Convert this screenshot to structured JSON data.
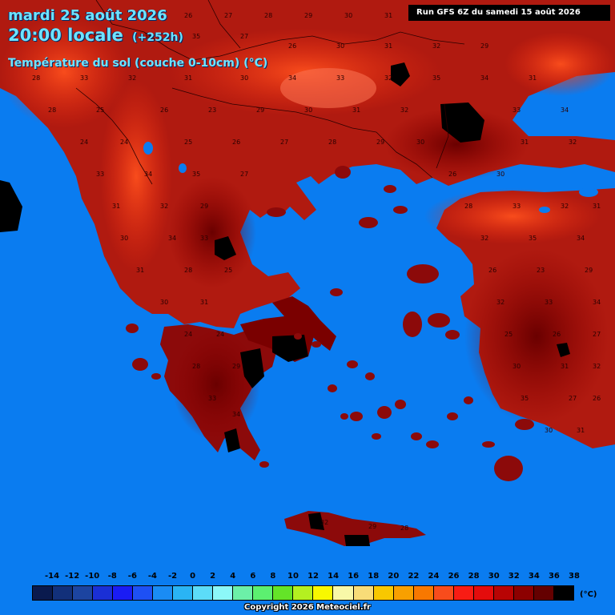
{
  "header": {
    "date": "mardi 25 août 2026",
    "time": "20:00 locale",
    "offset": "(+252h)",
    "parameter": "Température du sol (couche 0-10cm) (°C)"
  },
  "run_info": "Run GFS 6Z du samedi 15 août 2026",
  "legend": {
    "labels": [
      "-14",
      "-12",
      "-10",
      "-8",
      "-6",
      "-4",
      "-2",
      "0",
      "2",
      "4",
      "6",
      "8",
      "10",
      "12",
      "14",
      "16",
      "18",
      "20",
      "22",
      "24",
      "26",
      "28",
      "30",
      "32",
      "34",
      "36",
      "38"
    ],
    "colors": [
      "#0a1a4e",
      "#12307a",
      "#1c44a0",
      "#1a2fd6",
      "#1a1cf4",
      "#1e50f4",
      "#1a8cf4",
      "#2ab4f4",
      "#5cdcf8",
      "#8cf8f8",
      "#6cf0a8",
      "#5cf070",
      "#64e428",
      "#b4f020",
      "#f8f800",
      "#f8f8a8",
      "#f8dc78",
      "#f8c800",
      "#f8a000",
      "#f87800",
      "#f84c1c",
      "#f81c14",
      "#e40c0c",
      "#b80404",
      "#8c0000",
      "#640000",
      "#000000"
    ],
    "unit": "(°C)"
  },
  "colors": {
    "sea": "#0a7cf0",
    "land_warm": "#a01010",
    "land_hot": "#7a0000",
    "land_mild": "#e82a10",
    "border": "#2a0000"
  },
  "map_labels": [
    {
      "text": "24"
    },
    {
      "text": "24"
    },
    {
      "text": "25"
    },
    {
      "text": "26"
    },
    {
      "text": "27"
    },
    {
      "text": "28"
    },
    {
      "text": "29"
    },
    {
      "text": "30"
    },
    {
      "text": "31"
    },
    {
      "text": "32"
    },
    {
      "text": "33"
    },
    {
      "text": "34"
    },
    {
      "text": "35"
    },
    {
      "text": "27"
    },
    {
      "text": "26"
    },
    {
      "text": "30"
    },
    {
      "text": "31"
    },
    {
      "text": "32"
    },
    {
      "text": "29"
    },
    {
      "text": "28"
    },
    {
      "text": "33"
    },
    {
      "text": "32"
    },
    {
      "text": "31"
    },
    {
      "text": "30"
    },
    {
      "text": "34"
    },
    {
      "text": "33"
    },
    {
      "text": "32"
    },
    {
      "text": "35"
    },
    {
      "text": "34"
    },
    {
      "text": "31"
    },
    {
      "text": "28"
    },
    {
      "text": "25"
    },
    {
      "text": "26"
    },
    {
      "text": "23"
    },
    {
      "text": "29"
    },
    {
      "text": "30"
    },
    {
      "text": "31"
    },
    {
      "text": "32"
    },
    {
      "text": "33"
    },
    {
      "text": "34"
    }
  ],
  "copyright": "Copyright 2026 Meteociel.fr"
}
